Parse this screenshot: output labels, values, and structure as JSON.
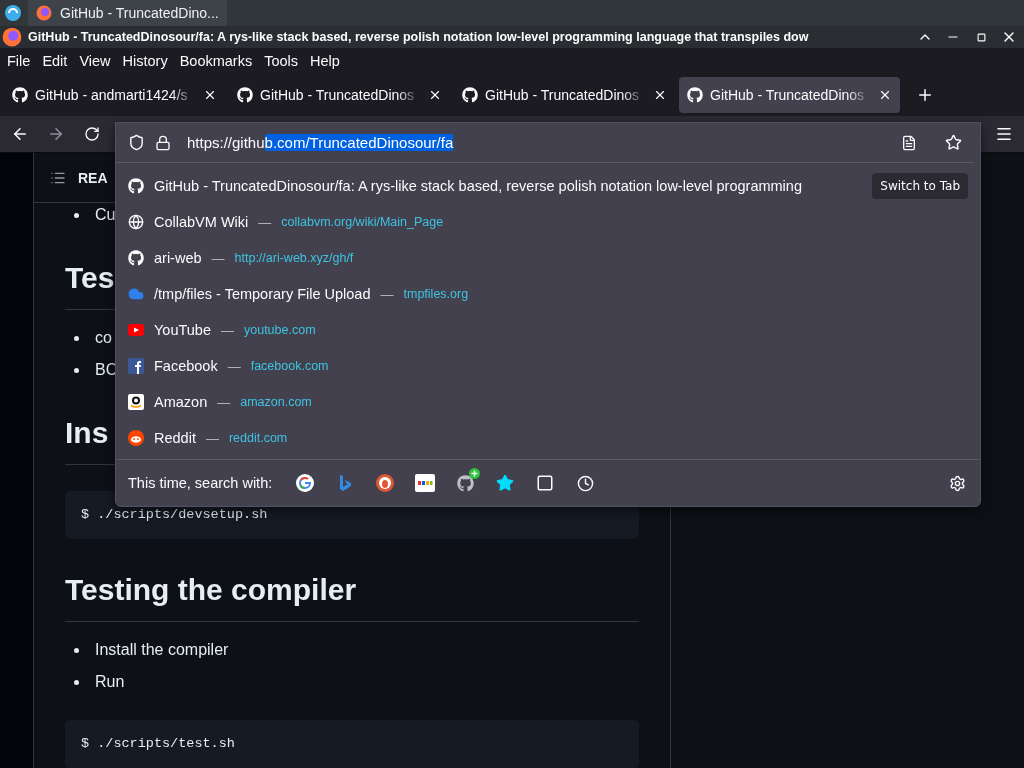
{
  "taskbar": {
    "task": "GitHub - TruncatedDino..."
  },
  "window": {
    "title": "GitHub - TruncatedDinosour/fa: A rys-like stack based, reverse polish notation low-level programming language that transpiles dow"
  },
  "menu": [
    "File",
    "Edit",
    "View",
    "History",
    "Bookmarks",
    "Tools",
    "Help"
  ],
  "tabs": [
    {
      "label": "GitHub - andmarti1424/s",
      "selected": false
    },
    {
      "label": "GitHub - TruncatedDinos",
      "selected": false
    },
    {
      "label": "GitHub - TruncatedDinos",
      "selected": false
    },
    {
      "label": "GitHub - TruncatedDinos",
      "selected": true
    }
  ],
  "urlbar": {
    "value": "https://githu",
    "selected_part": "b.com/TruncatedDinosour/fa"
  },
  "suggestions": [
    {
      "title": "GitHub - TruncatedDinosour/fa: A rys-like stack based, reverse polish notation low-level programming",
      "action": "Switch to Tab"
    },
    {
      "title": "CollabVM Wiki",
      "separator": "—",
      "url": "collabvm.org/wiki/Main_Page"
    },
    {
      "title": "ari-web",
      "separator": "—",
      "url": "http://ari-web.xyz/gh/f"
    },
    {
      "title": "/tmp/files - Temporary File Upload",
      "separator": "—",
      "url": "tmpfiles.org"
    },
    {
      "title": "YouTube",
      "separator": "—",
      "url": "youtube.com"
    },
    {
      "title": "Facebook",
      "separator": "—",
      "url": "facebook.com"
    },
    {
      "title": "Amazon",
      "separator": "—",
      "url": "amazon.com"
    },
    {
      "title": "Reddit",
      "separator": "—",
      "url": "reddit.com"
    }
  ],
  "search_with": {
    "label": "This time, search with:"
  },
  "page": {
    "toc_label": "REA",
    "content": [
      {
        "kind": "bullet",
        "text": "Cu"
      },
      {
        "kind": "heading",
        "text": "Tes"
      },
      {
        "kind": "bullet",
        "text": "co"
      },
      {
        "kind": "bullet",
        "text": "BC"
      },
      {
        "kind": "heading",
        "text": "Ins"
      },
      {
        "kind": "code",
        "text": "$ ./scripts/devsetup.sh"
      },
      {
        "kind": "heading",
        "text": "Testing the compiler"
      },
      {
        "kind": "bullet",
        "text": "Install the compiler"
      },
      {
        "kind": "bullet",
        "text": "Run"
      },
      {
        "kind": "code",
        "text": "$ ./scripts/test.sh"
      }
    ]
  }
}
